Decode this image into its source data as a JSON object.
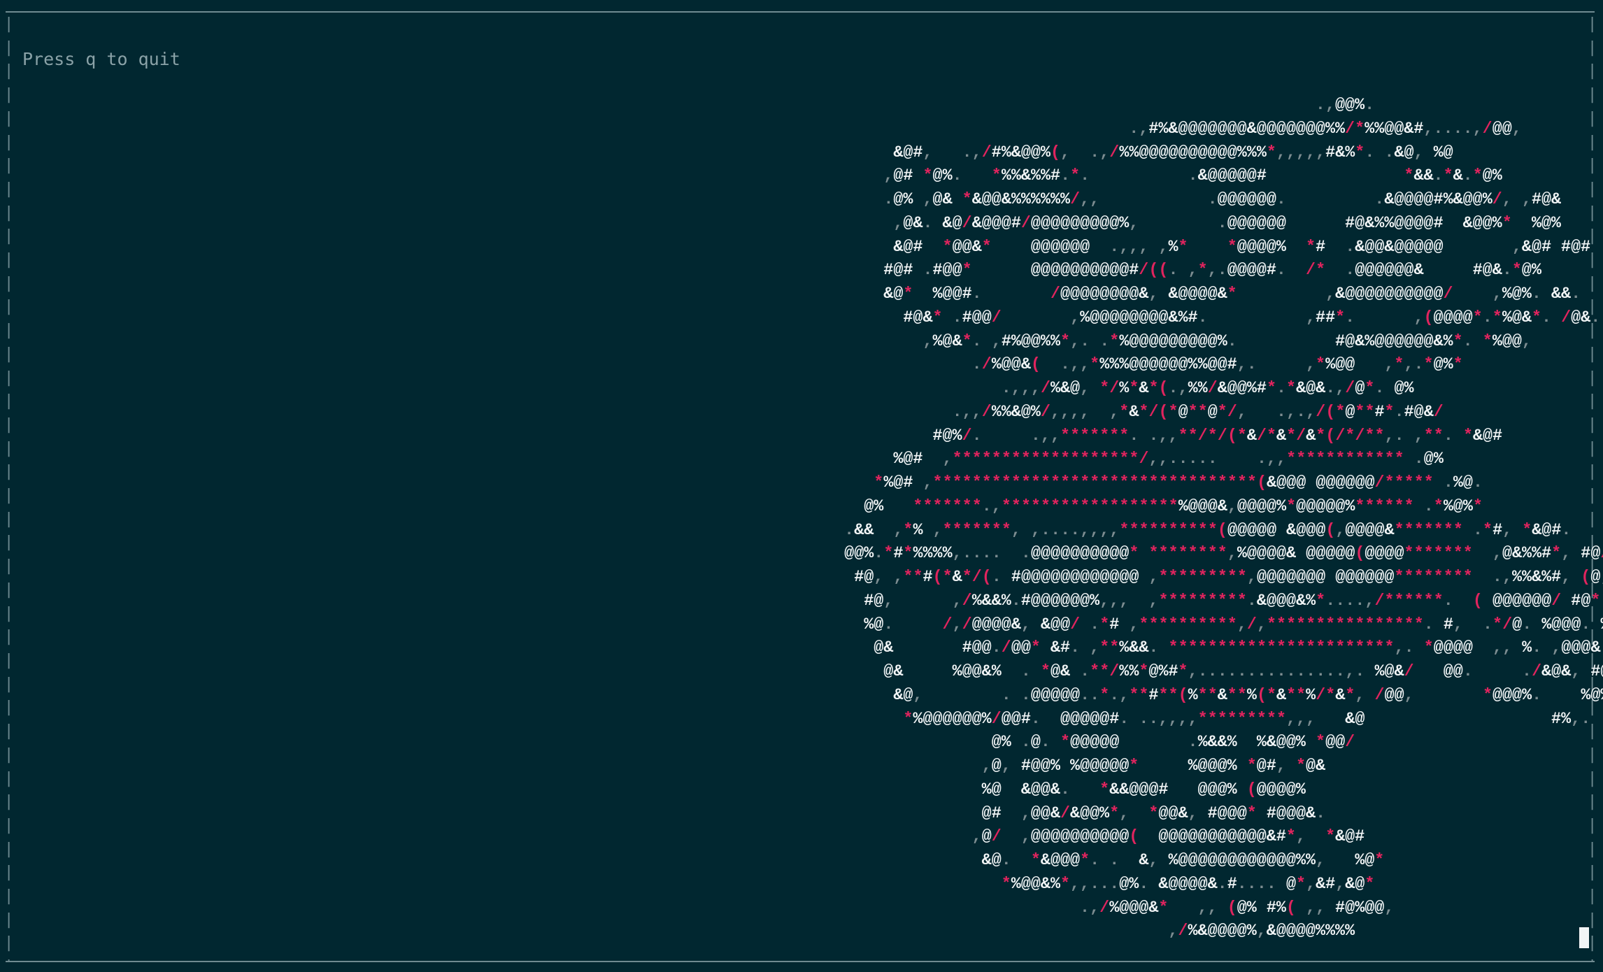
{
  "terminal": {
    "hint": "Press q to quit",
    "colors": {
      "background": "#012730",
      "border": "#6f8b91",
      "hint_text": "#8aa2a7",
      "art_primary": "#f2f5f6",
      "art_accent": "#e0245e",
      "art_dim": "#7d8d91"
    },
    "cursor_icon": "block-cursor-icon",
    "ascii_art": [
      "                                                                                                                                      .,@@%.",
      "                                                                                                                   .,#%&@@@@@@@&@@@@@@@%%/*%%@@&#,....,/@@,",
      "                                                                                           &@#,   .,/#%&@@%(,  .,/%%@@@@@@@@@@%%%*,,,,,#&%*. .&@, %@",
      "                                                                                          ,@# *@%.   *%%&%%#.*.          .&@@@@@#              *&&.*&.*@%",
      "                                                                                          .@% ,@& *&@@&%%%%%%/,,           .@@@@@@.         .&@@@@#%&@@%/, ,#@&",
      "                                                                                           ,@&. &@/&@@@#/@@@@@@@@@%,        .@@@@@@      #@&%%@@@@#  &@@%*  %@%",
      "                                                                                           &@#  *@@&*    @@@@@@  .,,, ,%*    *@@@@%  *#  .&@@&@@@@@       ,&@# #@#",
      "                                                                                          #@# .#@@*      @@@@@@@@@@#/((. ,*,.@@@@#.  /*  .@@@@@@&     #@&.*@%",
      "                                                                                          &@*  %@@#.       /@@@@@@@@&, &@@@@&*         ,&@@@@@@@@@@/    ,%@%. &&.",
      "                                                                                            #@&* .#@@/       ,%@@@@@@@@&%#.          ,##*.      ,(@@@@*.*%@&*. /@&.",
      "                                                                                              ,%@&*. ,#%@@%%*,. .*%@@@@@@@@@%.          #@&%@@@@@@&%*. *%@@,",
      "                                                                                                   ./%@@&(  .,,*%%%@@@@@@%%@@#,.     ,*%@@   ,*,.*@%*",
      "                                                                                                      .,,,/%&@, */%*&*(.,%%/&@@%#*.*&@&.,/@*. @%",
      "                                                                                                 .,,/%%&@%/,,,,  ,*&*/(*@**@*/,   .,.,/(*@**#*.#@&/",
      "                                                                                               #@%/.     .,,*******. .,,**/*/(*&/*&*/&*(/*/**,. ,**. *&@#",
      "                                                                                           %@#  ,*******************/,,.....    .,,************ .@%",
      "                                                                                         *%@# ,*********************************(&@@@ @@@@@@/***** .%@.",
      "                                                                                        @%   *******.,******************%@@@&,@@@@%*@@@@@%****** .*%@%*",
      "                                                                                      .&&  ,*% ,*******, ,....,,,,**********(@@@@@ &@@@(,@@@@&******* .*#, *&@#.",
      "                                                                                      @@%.*#*%%%%,....  .@@@@@@@@@@* ********,%@@@@& @@@@@(@@@@*******  ,@&%%#*, #@/",
      "                                                                                       #@, ,**#(*&*/(. #@@@@@@@@@@@@ ,*********,@@@@@@@ @@@@@@********  .,%%&%#, (@,",
      "                                                                                        #@,      ,/%&&%.#@@@@@@%,,,  ,*********.&@@@&%*....,/******.  ( @@@@@@/ #@*",
      "                                                                                        %@.     /,/@@@@&, &@@/ .*# ,**********,/,****************. #,  .*/@. %@@@. %",
      "                                                                                         @&       #@@./@@* &#. ,**%&&. ***********************,. *@@@@  ,, %. ,@@@& *",
      "                                                                                          @&     %@@&%  . *@& .**/%%*@%#*,...............,. %@&/   @@.     ./&@&, #@&",
      "                                                                                           &@,        . .@@@@@..*.,**#**(%**&**%(*&**%/*&*, /@@,       *@@@%.    %@%.",
      "                                                                                            *%@@@@@@%/@@#.  @@@@@#. ..,,,,*********,,,   &@                   #%,.",
      "                                                                                                     @% .@. *@@@@@       .%&&%  %&@@% *@@/",
      "                                                                                                    ,@, #@@% %@@@@@*     %@@@% *@#, *@&",
      "                                                                                                    %@  &@@&.   *&&@@@#   @@@% (@@@@%",
      "                                                                                                    @#  ,@@&/&@@%*,  *@@&, #@@@* #@@@&.",
      "                                                                                                   ,@/  ,@@@@@@@@@@(  @@@@@@@@@@@&#*,  *&@#",
      "                                                                                                    &@.  *&@@@*. .  &, %@@@@@@@@@@@@%%,   %@*",
      "                                                                                                      *%@@&%*,,...@%. &@@@@&.#.... @*,&#,&@*",
      "                                                                                                              .,/%@@@&*   ,, (@% #%( ,, #@%@@,",
      "                                                                                                                       ,/%&@@@@%,&@@@@%%%%"
    ]
  }
}
